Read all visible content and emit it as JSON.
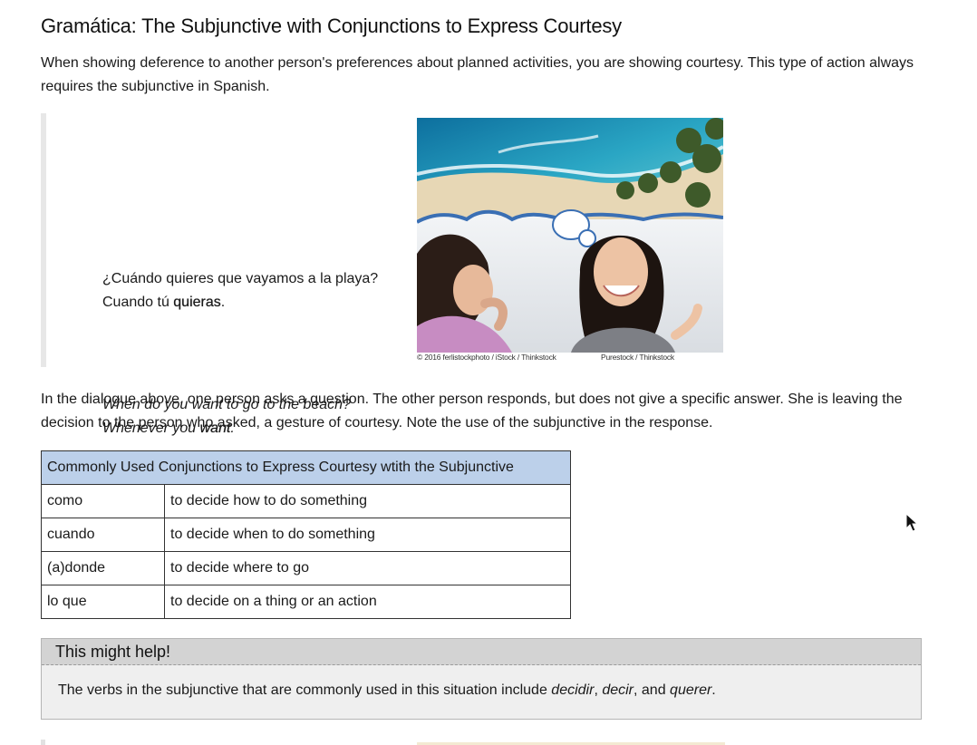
{
  "title": "Gramática: The Subjunctive with Conjunctions to Express Courtesy",
  "intro": "When showing deference to another person's preferences about planned activities, you are showing courtesy. This type of action always requires the subjunctive in Spanish.",
  "dialogue": {
    "es_line1": "¿Cuándo quieres que vayamos a la playa?",
    "es_line2_prefix": "Cuando tú ",
    "es_line2_bold": "quieras",
    "es_line2_suffix": ".",
    "en_line1": "When do you want to go to the beach?",
    "en_line2_prefix": "Whenever you ",
    "en_line2_bold": "want",
    "en_line2_suffix": "."
  },
  "image": {
    "alt": "Two women talking with a thought bubble showing a tropical beach",
    "credit_left": "© 2016 ferlistockphoto / iStock / Thinkstock",
    "credit_right": "Purestock / Thinkstock"
  },
  "paragraph2": "In the dialogue above, one person asks a question. The other person responds, but does not give a specific answer. She is leaving the decision to the person who asked, a gesture of courtesy. Note the use of the subjunctive in the response.",
  "table": {
    "header": "Commonly Used Conjunctions to Express Courtesy wtith the Subjunctive",
    "rows": [
      [
        "como",
        "to decide how to do something"
      ],
      [
        "cuando",
        "to decide when to do something"
      ],
      [
        "(a)donde",
        "to decide where to go"
      ],
      [
        "lo que",
        "to decide on a thing or an action"
      ]
    ]
  },
  "help": {
    "title": "This might help!",
    "body_prefix": "The verbs in the subjunctive that are commonly used in this situation include ",
    "term1": "decidir",
    "sep1": ", ",
    "term2": "decir",
    "sep2": ", and ",
    "term3": "querer",
    "suffix": "."
  },
  "colors": {
    "table_header_bg": "#bcd0ea",
    "help_header_bg": "#d3d3d3",
    "help_body_bg": "#efefef"
  }
}
